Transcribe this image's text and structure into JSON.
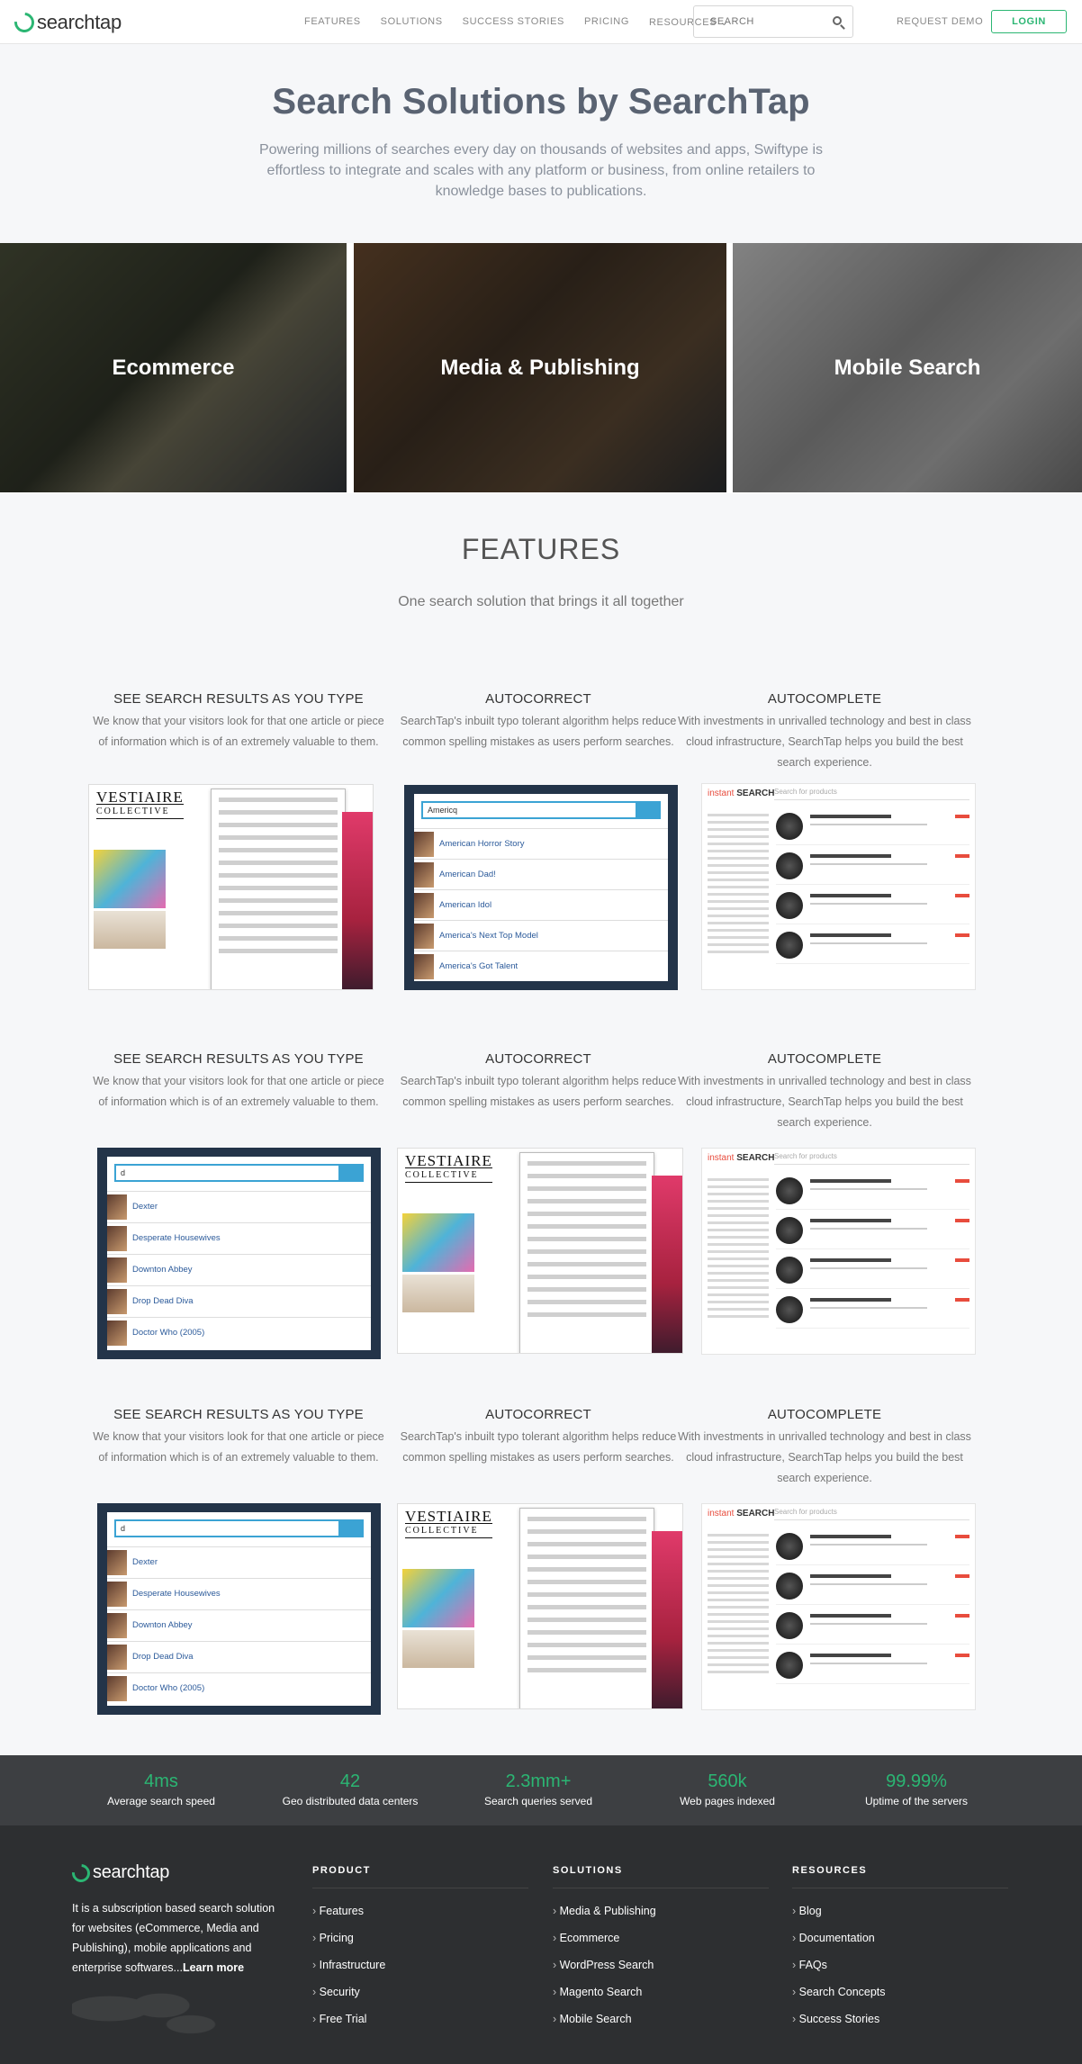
{
  "nav": {
    "logo": "searchtap",
    "links": [
      "FEATURES",
      "SOLUTIONS",
      "SUCCESS STORIES",
      "PRICING",
      "RESOURCES"
    ],
    "search_placeholder": "SEARCH",
    "request_demo": "REQUEST DEMO",
    "login": "LOGIN"
  },
  "hero": {
    "title": "Search Solutions by SearchTap",
    "subtitle": "Powering millions of searches every day on thousands of websites and apps, Swiftype is effortless to integrate and scales with any platform or business, from online retailers to knowledge bases to publications."
  },
  "solutions": [
    "Ecommerce",
    "Media & Publishing",
    "Mobile Search"
  ],
  "features": {
    "title": "FEATURES",
    "subtitle": "One search solution that brings it all together",
    "rows": [
      [
        {
          "title": "SEE SEARCH RESULTS AS YOU TYPE",
          "desc": "We know that your visitors look for that one article or piece of information which is of an extremely valuable to them."
        },
        {
          "title": "AUTOCORRECT",
          "desc": "SearchTap's inbuilt typo tolerant algorithm helps reduce common spelling mistakes as users perform searches."
        },
        {
          "title": "AUTOCOMPLETE",
          "desc": "With investments in unrivalled technology and best in class cloud infrastructure, SearchTap helps you build the best search experience."
        }
      ],
      [
        {
          "title": "SEE SEARCH RESULTS AS YOU TYPE",
          "desc": "We know that your visitors look for that one article or piece of information which is of an extremely valuable to them."
        },
        {
          "title": "AUTOCORRECT",
          "desc": "SearchTap's inbuilt typo tolerant algorithm helps reduce common spelling mistakes as users perform searches."
        },
        {
          "title": "AUTOCOMPLETE",
          "desc": "With investments in unrivalled technology and best in class cloud infrastructure, SearchTap helps you build the best search experience."
        }
      ],
      [
        {
          "title": "SEE SEARCH RESULTS AS YOU TYPE",
          "desc": "We know that your visitors look for that one article or piece of information which is of an extremely valuable to them."
        },
        {
          "title": "AUTOCORRECT",
          "desc": "SearchTap's inbuilt typo tolerant algorithm helps reduce common spelling mistakes as users perform searches."
        },
        {
          "title": "AUTOCOMPLETE",
          "desc": "With investments in unrivalled technology and best in class cloud infrastructure, SearchTap helps you build the best search experience."
        }
      ]
    ],
    "tv_demo_a": {
      "query": "Americq",
      "results": [
        "American Horror Story",
        "American Dad!",
        "American Idol",
        "America's Next Top Model",
        "America's Got Talent"
      ]
    },
    "tv_demo_b": {
      "query": "d",
      "results": [
        "Dexter",
        "Desperate Housewives",
        "Downton Abbey",
        "Drop Dead Diva",
        "Doctor Who (2005)"
      ]
    },
    "fashion_brand": "VESTIAIRE",
    "fashion_brand_sub": "COLLECTIVE",
    "shop_logo_a": "instant",
    "shop_logo_b": "SEARCH",
    "shop_placeholder": "Search for products"
  },
  "stats": [
    {
      "value": "4ms",
      "label": "Average search speed"
    },
    {
      "value": "42",
      "label": "Geo distributed data centers"
    },
    {
      "value": "2.3mm+",
      "label": "Search queries served"
    },
    {
      "value": "560k",
      "label": "Web pages indexed"
    },
    {
      "value": "99.99%",
      "label": "Uptime of the servers"
    }
  ],
  "footer": {
    "logo": "searchtap",
    "desc": "It is a subscription based search solution for websites (eCommerce, Media and Publishing), mobile applications and enterprise softwares...",
    "learn_more": "Learn more",
    "columns": [
      {
        "title": "PRODUCT",
        "items": [
          "Features",
          "Pricing",
          "Infrastructure",
          "Security",
          "Free Trial"
        ]
      },
      {
        "title": "SOLUTIONS",
        "items": [
          "Media & Publishing",
          "Ecommerce",
          "WordPress Search",
          "Magento Search",
          "Mobile Search"
        ]
      },
      {
        "title": "RESOURCES",
        "items": [
          "Blog",
          "Documentation",
          "FAQs",
          "Search Concepts",
          "Success Stories"
        ]
      }
    ]
  },
  "colors": {
    "brand_green": "#2bb673",
    "accent_blue": "#3ba3d4",
    "footer_bg": "#2d2f31",
    "stats_bg": "#3d3f42"
  }
}
